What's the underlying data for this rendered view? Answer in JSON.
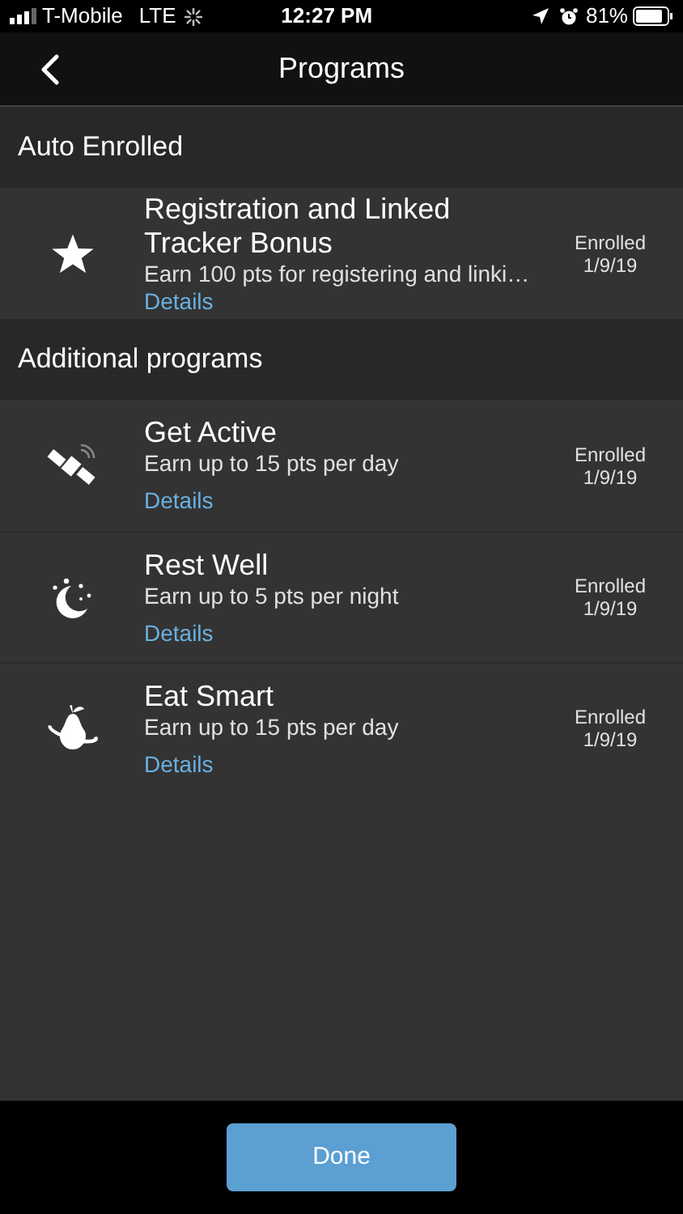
{
  "status_bar": {
    "carrier": "T-Mobile",
    "network": "LTE",
    "time": "12:27 PM",
    "battery": "81%"
  },
  "nav": {
    "title": "Programs"
  },
  "sections": [
    {
      "title": "Auto Enrolled",
      "programs": [
        {
          "title": "Registration and Linked Tracker Bonus",
          "description": "Earn 100 pts for registering and linki…",
          "link": "Details",
          "status": "Enrolled",
          "date": "1/9/19"
        }
      ]
    },
    {
      "title": "Additional programs",
      "programs": [
        {
          "title": "Get Active",
          "description": "Earn up to 15 pts per day",
          "link": "Details",
          "status": "Enrolled",
          "date": "1/9/19"
        },
        {
          "title": "Rest Well",
          "description": "Earn up to 5 pts per night",
          "link": "Details",
          "status": "Enrolled",
          "date": "1/9/19"
        },
        {
          "title": "Eat Smart",
          "description": "Earn up to 15 pts per day",
          "link": "Details",
          "status": "Enrolled",
          "date": "1/9/19"
        }
      ]
    }
  ],
  "done_button": "Done"
}
